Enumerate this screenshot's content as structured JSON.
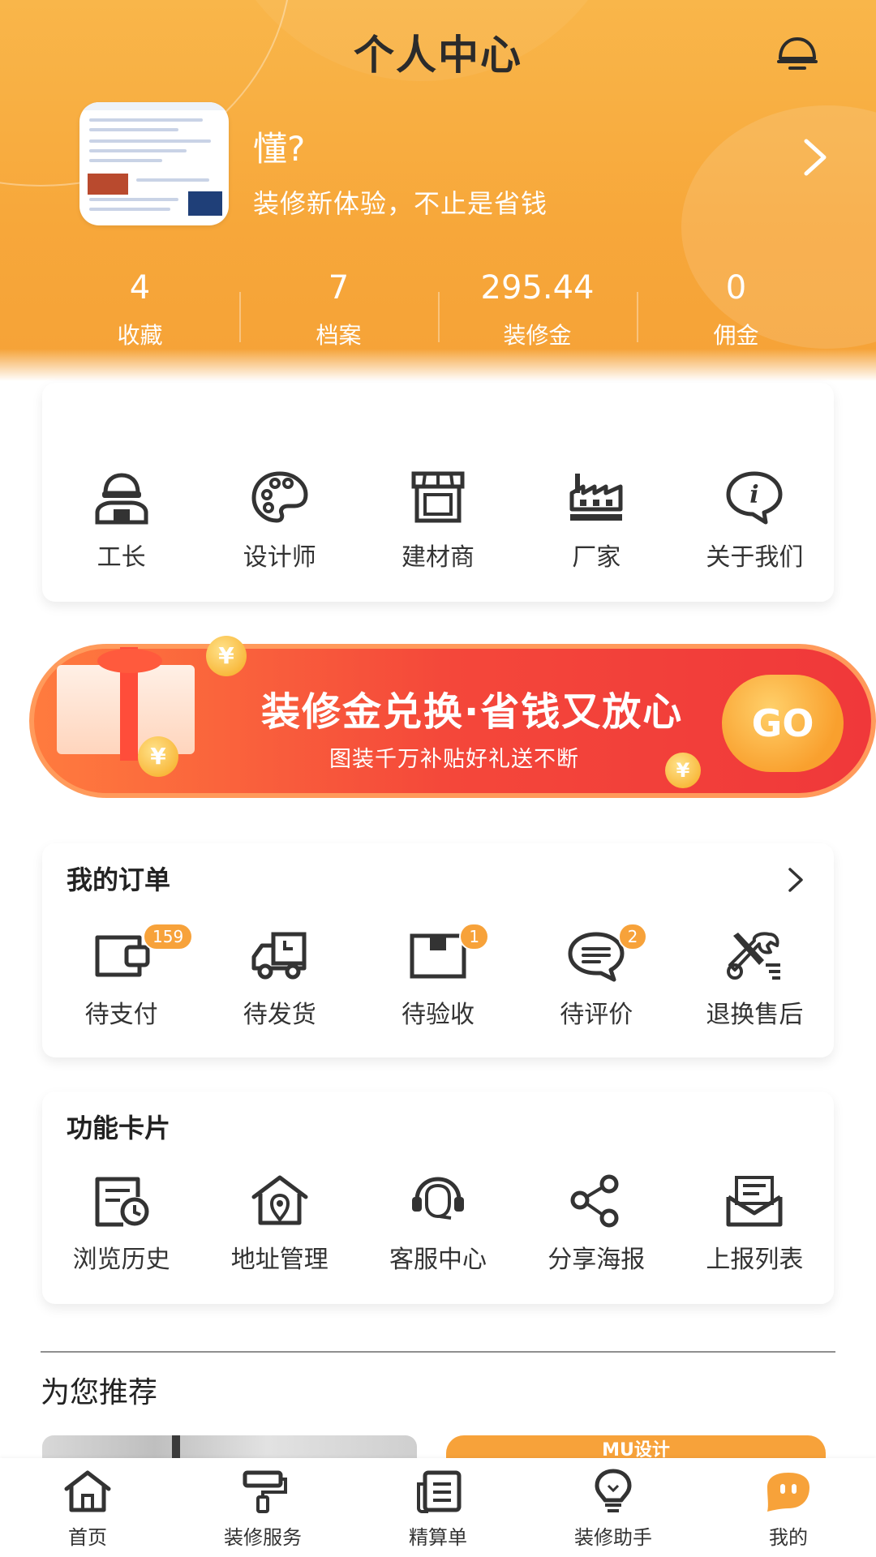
{
  "header": {
    "title": "个人中心",
    "username": "懂?",
    "slogan": "装修新体验，不止是省钱",
    "stats": [
      {
        "value": "4",
        "label": "收藏"
      },
      {
        "value": "7",
        "label": "档案"
      },
      {
        "value": "295.44",
        "label": "装修金"
      },
      {
        "value": "0",
        "label": "佣金"
      }
    ]
  },
  "roles": [
    {
      "label": "工长",
      "icon": "foreman-icon"
    },
    {
      "label": "设计师",
      "icon": "palette-icon"
    },
    {
      "label": "建材商",
      "icon": "store-icon"
    },
    {
      "label": "厂家",
      "icon": "factory-icon"
    },
    {
      "label": "关于我们",
      "icon": "info-icon"
    }
  ],
  "banner": {
    "title": "装修金兑换·省钱又放心",
    "subtitle": "图装千万补贴好礼送不断",
    "go": "GO",
    "coin_symbol": "¥"
  },
  "orders": {
    "title": "我的订单",
    "items": [
      {
        "label": "待支付",
        "badge": "159",
        "icon": "wallet-icon"
      },
      {
        "label": "待发货",
        "badge": "",
        "icon": "truck-icon"
      },
      {
        "label": "待验收",
        "badge": "1",
        "icon": "box-icon"
      },
      {
        "label": "待评价",
        "badge": "2",
        "icon": "comment-icon"
      },
      {
        "label": "退换售后",
        "badge": "",
        "icon": "tools-icon"
      }
    ]
  },
  "features": {
    "title": "功能卡片",
    "items": [
      {
        "label": "浏览历史",
        "icon": "history-icon"
      },
      {
        "label": "地址管理",
        "icon": "address-icon"
      },
      {
        "label": "客服中心",
        "icon": "headset-icon"
      },
      {
        "label": "分享海报",
        "icon": "share-icon"
      },
      {
        "label": "上报列表",
        "icon": "mail-list-icon"
      }
    ]
  },
  "recommend": {
    "title": "为您推荐",
    "card2_label": "MU设计"
  },
  "tabbar": [
    {
      "label": "首页",
      "icon": "home-icon",
      "active": false
    },
    {
      "label": "装修服务",
      "icon": "paint-roller-icon",
      "active": false
    },
    {
      "label": "精算单",
      "icon": "ledger-icon",
      "active": false
    },
    {
      "label": "装修助手",
      "icon": "bulb-icon",
      "active": false
    },
    {
      "label": "我的",
      "icon": "profile-face-icon",
      "active": true
    }
  ],
  "colors": {
    "brand_orange": "#f7a73a",
    "banner_red": "#f0383a",
    "text_dark": "#222222"
  }
}
